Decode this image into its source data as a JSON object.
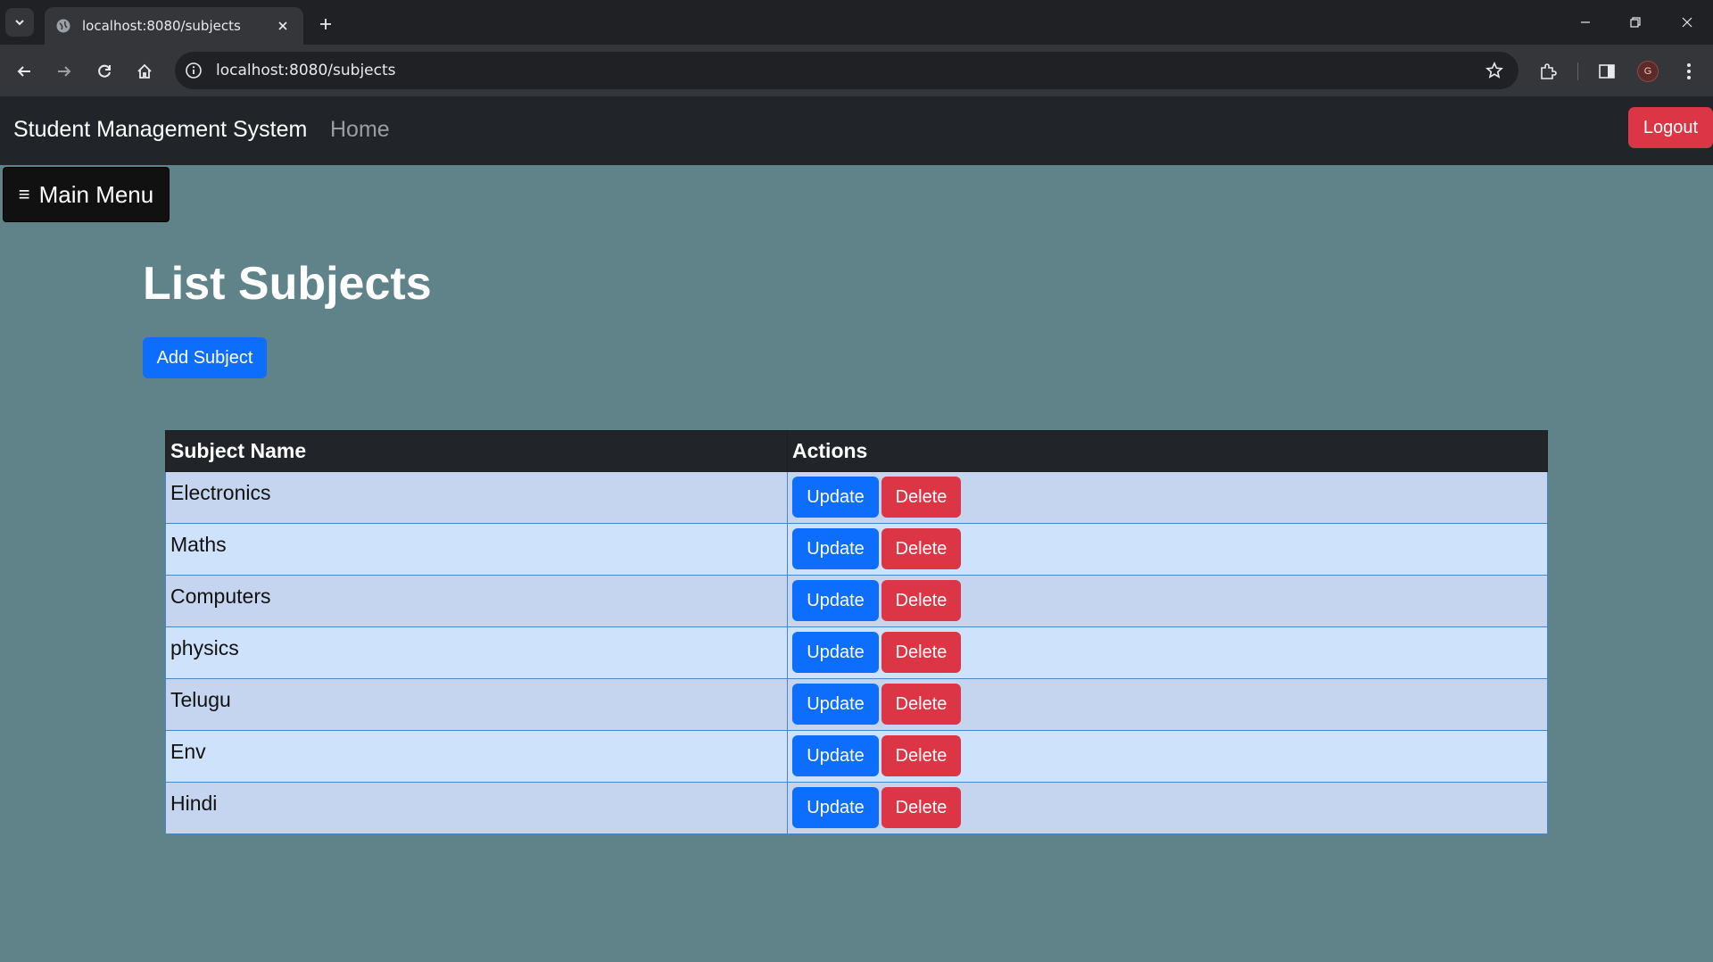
{
  "browser": {
    "tab_title": "localhost:8080/subjects",
    "url": "localhost:8080/subjects",
    "profile_initial": "G"
  },
  "navbar": {
    "brand": "Student Management System",
    "home_link": "Home",
    "logout_label": "Logout"
  },
  "menu": {
    "label": "Main Menu",
    "icon": "≡"
  },
  "page": {
    "title": "List Subjects",
    "add_button": "Add Subject"
  },
  "table": {
    "headers": [
      "Subject Name",
      "Actions"
    ],
    "rows": [
      {
        "name": "Electronics",
        "update": "Update",
        "delete": "Delete"
      },
      {
        "name": "Maths",
        "update": "Update",
        "delete": "Delete"
      },
      {
        "name": "Computers",
        "update": "Update",
        "delete": "Delete"
      },
      {
        "name": "physics",
        "update": "Update",
        "delete": "Delete"
      },
      {
        "name": "Telugu",
        "update": "Update",
        "delete": "Delete"
      },
      {
        "name": "Env",
        "update": "Update",
        "delete": "Delete"
      },
      {
        "name": "Hindi",
        "update": "Update",
        "delete": "Delete"
      }
    ]
  },
  "colors": {
    "page_background": "#5f8388",
    "navbar": "#212529",
    "primary": "#0d6efd",
    "danger": "#dc3545"
  }
}
